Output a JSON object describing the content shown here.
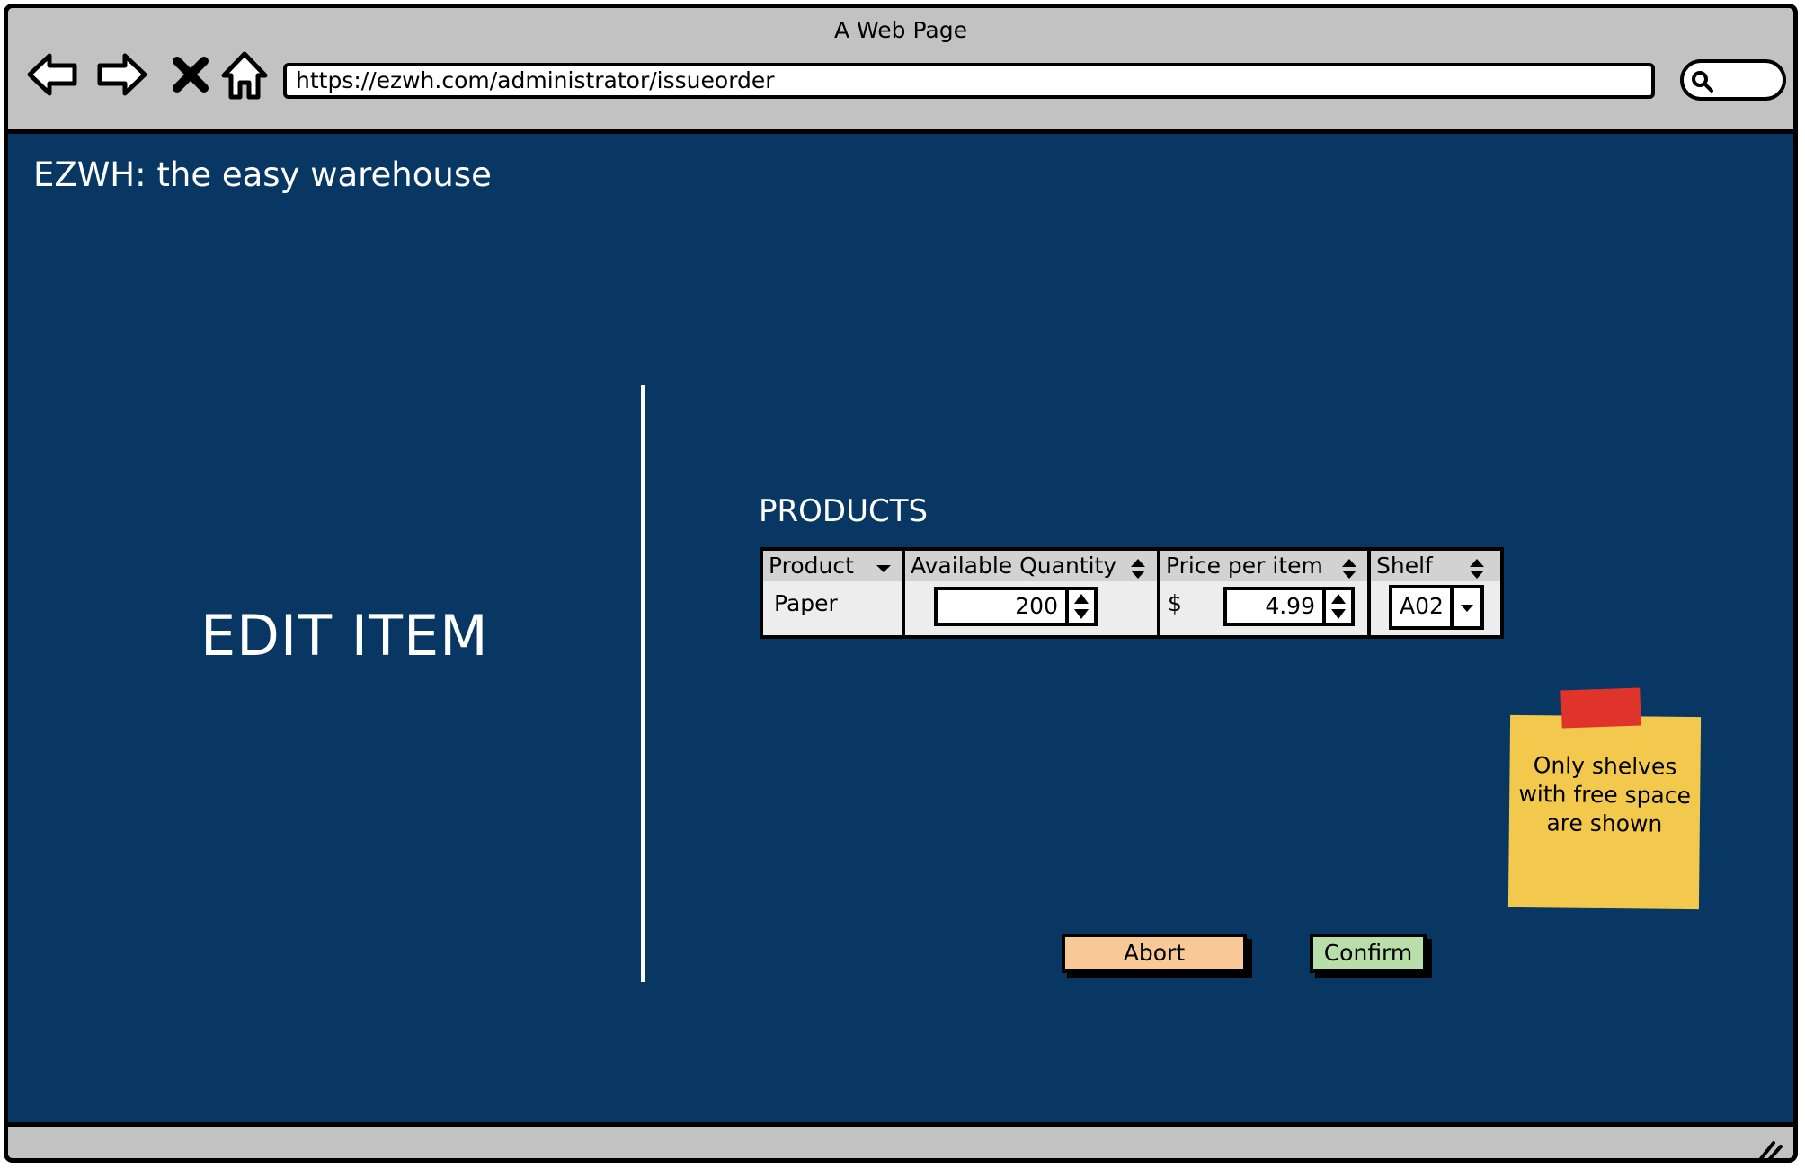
{
  "browser": {
    "title": "A Web Page",
    "url": "https://ezwh.com/administrator/issueorder",
    "nav_icons": [
      "back-arrow-icon",
      "forward-arrow-icon",
      "stop-icon",
      "home-icon"
    ],
    "search_icon": "search-icon"
  },
  "page": {
    "brand": "EZWH: the easy warehouse",
    "section_title": "EDIT ITEM",
    "background_color": "#083763"
  },
  "products": {
    "label": "PRODUCTS",
    "columns": [
      {
        "label": "Product",
        "control": "dropdown"
      },
      {
        "label": "Available Quantity",
        "control": "sort"
      },
      {
        "label": "Price per item",
        "control": "sort"
      },
      {
        "label": "Shelf",
        "control": "sort"
      }
    ],
    "rows": [
      {
        "product": "Paper",
        "available_quantity": "200",
        "currency": "$",
        "price": "4.99",
        "shelf": "A02"
      }
    ]
  },
  "note": {
    "text": "Only shelves with free space are shown",
    "color": "#f2c94c",
    "tape_color": "#e0332b"
  },
  "actions": {
    "abort_label": "Abort",
    "abort_color": "#f9c897",
    "confirm_label": "Confirm",
    "confirm_color": "#b8deaa"
  }
}
